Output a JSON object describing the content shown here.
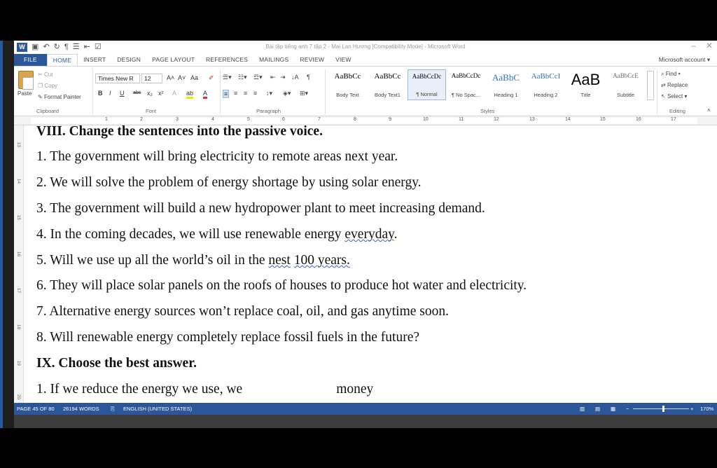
{
  "title_bar": {
    "document_title": "Bài tập tiếng anh 7 tập 2 - Mai Lan Hương [Compatibility Mode] - Microsoft Word",
    "app_icon": "word-logo",
    "qat_icons": [
      "save-icon",
      "undo-icon",
      "redo-icon",
      "paragraph-mark-icon",
      "bullets-icon",
      "outdent-icon",
      "check-icon"
    ]
  },
  "tabs": [
    "FILE",
    "HOME",
    "INSERT",
    "DESIGN",
    "PAGE LAYOUT",
    "REFERENCES",
    "MAILINGS",
    "REVIEW",
    "VIEW"
  ],
  "active_tab": "HOME",
  "account": "Microsoft account",
  "ribbon": {
    "clipboard": {
      "paste": "Paste",
      "cut": "Cut",
      "copy": "Copy",
      "format_painter": "Format Painter",
      "label": "Clipboard"
    },
    "font": {
      "name": "Times New R",
      "size": "12",
      "label": "Font"
    },
    "paragraph": {
      "label": "Paragraph"
    },
    "styles": {
      "label": "Styles",
      "items": [
        {
          "sample": "AaBbCc",
          "name": "Body Text"
        },
        {
          "sample": "AaBbCc",
          "name": "Body Text1"
        },
        {
          "sample": "AaBbCcDc",
          "name": "¶ Normal"
        },
        {
          "sample": "AaBbCcDc",
          "name": "¶ No Spac..."
        },
        {
          "sample": "AaBbC",
          "name": "Heading 1"
        },
        {
          "sample": "AaBbCcI",
          "name": "Heading 2"
        },
        {
          "sample": "AaB",
          "name": "Title"
        },
        {
          "sample": "AaBbCcE",
          "name": "Subtitle"
        }
      ],
      "selected": "¶ Normal"
    },
    "editing": {
      "find": "Find",
      "replace": "Replace",
      "select": "Select",
      "label": "Editing"
    }
  },
  "ruler": {
    "numbers": [
      "1",
      "2",
      "3",
      "4",
      "5",
      "6",
      "7",
      "8",
      "9",
      "10",
      "11",
      "12",
      "13",
      "14",
      "15",
      "16",
      "17"
    ]
  },
  "vruler": {
    "numbers": [
      "13",
      "14",
      "15",
      "16",
      "17",
      "18",
      "19",
      "20"
    ]
  },
  "document": {
    "section8_title": "VIII. Change the sentences into the passive voice.",
    "section8_items": [
      "1. The government will bring electricity to remote areas next year.",
      "2. We will solve the problem of energy shortage by using solar energy.",
      "3. The government will build a new hydropower plant to meet increasing demand.",
      "4. In the coming decades, we will use renewable energy everyday.",
      "5. Will we use up all the world’s oil in the nest 100 years.",
      "6. They will place solar panels on the roofs of houses to produce hot water and electricity.",
      "7. Alternative energy sources won’t replace coal, oil, and gas anytime soon.",
      "8. Will renewable energy completely replace fossil fuels in the future?"
    ],
    "section9_title": "IX. Choose the best answer.",
    "section9_first_item_start": "1. If we reduce the energy we use, we",
    "section9_first_item_end": "money"
  },
  "status_bar": {
    "page": "PAGE 45 OF 80",
    "words": "26194 WORDS",
    "language": "ENGLISH (UNITED STATES)",
    "zoom": "170%"
  },
  "colors": {
    "word_blue": "#2b579a",
    "spellcheck": "#3a5fcd"
  }
}
